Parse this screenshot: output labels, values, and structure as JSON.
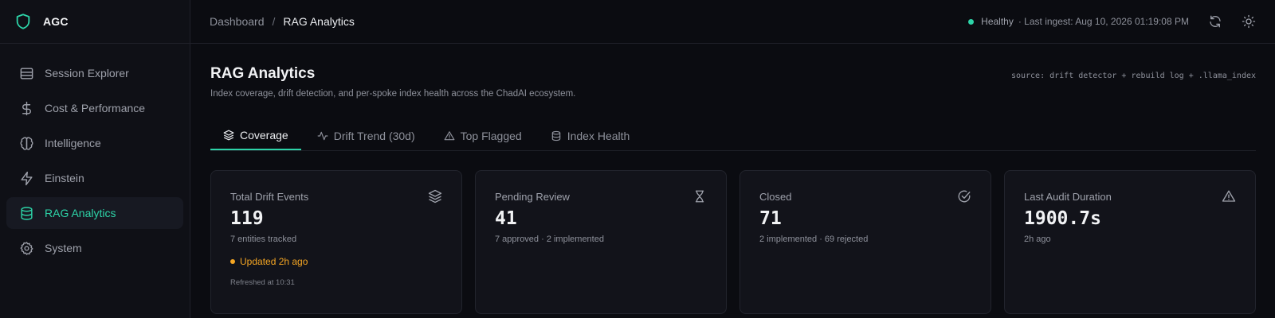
{
  "brand": {
    "name": "AGC",
    "logo_icon": "shield-icon",
    "accent": "#2dd4a8"
  },
  "sidebar": {
    "items": [
      {
        "label": "Session Explorer",
        "icon": "table-icon",
        "active": false
      },
      {
        "label": "Cost & Performance",
        "icon": "dollar-icon",
        "active": false
      },
      {
        "label": "Intelligence",
        "icon": "brain-icon",
        "active": false
      },
      {
        "label": "Einstein",
        "icon": "bolt-icon",
        "active": false
      },
      {
        "label": "RAG Analytics",
        "icon": "database-icon",
        "active": true
      },
      {
        "label": "System",
        "icon": "gear-icon",
        "active": false
      }
    ]
  },
  "header": {
    "breadcrumb": {
      "parent": "Dashboard",
      "separator": "/",
      "current": "RAG Analytics"
    },
    "status": {
      "label": "Healthy",
      "last_ingest": "· Last ingest: Aug 10, 2026 01:19:08 PM",
      "color": "#2dd4a8"
    },
    "buttons": [
      "refresh-icon",
      "sun-icon"
    ]
  },
  "page": {
    "title": "RAG Analytics",
    "subtitle": "Index coverage, drift detection, and per-spoke index health across the ChadAI ecosystem.",
    "source": "source: drift detector + rebuild log + .llama_index"
  },
  "tabs": [
    {
      "label": "Coverage",
      "icon": "layers-icon",
      "active": true
    },
    {
      "label": "Drift Trend (30d)",
      "icon": "activity-icon",
      "active": false
    },
    {
      "label": "Top Flagged",
      "icon": "warning-icon",
      "active": false
    },
    {
      "label": "Index Health",
      "icon": "database-icon",
      "active": false
    }
  ],
  "cards": [
    {
      "label": "Total Drift Events",
      "value": "119",
      "sub": "7 entities tracked",
      "updated": "Updated 2h ago",
      "refreshed": "Refreshed at 10:31",
      "icon": "layers-icon",
      "updated_color": "#f5a623"
    },
    {
      "label": "Pending Review",
      "value": "41",
      "sub": "7 approved · 2 implemented",
      "icon": "hourglass-icon"
    },
    {
      "label": "Closed",
      "value": "71",
      "sub": "2 implemented · 69 rejected",
      "icon": "check-circle-icon"
    },
    {
      "label": "Last Audit Duration",
      "value": "1900.7s",
      "sub": "2h ago",
      "icon": "warning-icon"
    }
  ]
}
